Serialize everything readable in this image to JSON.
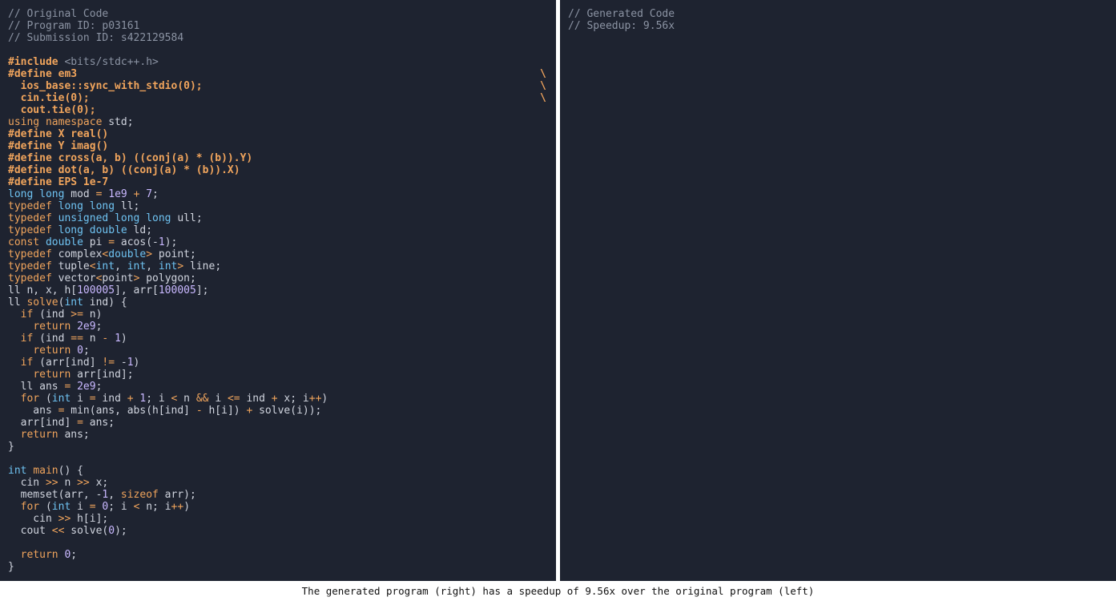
{
  "left_panel": {
    "lines": [
      [
        [
          "comment",
          "// Original Code"
        ]
      ],
      [
        [
          "comment",
          "// Program ID: p03161"
        ]
      ],
      [
        [
          "comment",
          "// Submission ID: s422129584"
        ]
      ],
      [],
      [
        [
          "pre",
          "#include "
        ],
        [
          "inc",
          "<bits/stdc++.h>"
        ]
      ],
      [
        [
          "pre",
          "#define em3"
        ],
        [
          "bs",
          "\\"
        ]
      ],
      [
        [
          "pre",
          "  ios_base::sync_with_stdio(0);"
        ],
        [
          "bs",
          "\\"
        ]
      ],
      [
        [
          "pre",
          "  cin.tie(0);"
        ],
        [
          "bs",
          "\\"
        ]
      ],
      [
        [
          "pre",
          "  cout.tie(0);"
        ]
      ],
      [
        [
          "kw",
          "using namespace"
        ],
        [
          "plain",
          " std;"
        ]
      ],
      [
        [
          "pre",
          "#define X real()"
        ]
      ],
      [
        [
          "pre",
          "#define Y imag()"
        ]
      ],
      [
        [
          "pre",
          "#define cross(a, b) ((conj(a) * (b)).Y)"
        ]
      ],
      [
        [
          "pre",
          "#define dot(a, b) ((conj(a) * (b)).X)"
        ]
      ],
      [
        [
          "pre",
          "#define EPS 1e-7"
        ]
      ],
      [
        [
          "type",
          "long long"
        ],
        [
          "plain",
          " mod "
        ],
        [
          "op",
          "="
        ],
        [
          "plain",
          " "
        ],
        [
          "num",
          "1e9"
        ],
        [
          "plain",
          " "
        ],
        [
          "op",
          "+"
        ],
        [
          "plain",
          " "
        ],
        [
          "num",
          "7"
        ],
        [
          "plain",
          ";"
        ]
      ],
      [
        [
          "kw",
          "typedef"
        ],
        [
          "plain",
          " "
        ],
        [
          "type",
          "long long"
        ],
        [
          "plain",
          " ll;"
        ]
      ],
      [
        [
          "kw",
          "typedef"
        ],
        [
          "plain",
          " "
        ],
        [
          "type",
          "unsigned long long"
        ],
        [
          "plain",
          " ull;"
        ]
      ],
      [
        [
          "kw",
          "typedef"
        ],
        [
          "plain",
          " "
        ],
        [
          "type",
          "long double"
        ],
        [
          "plain",
          " ld;"
        ]
      ],
      [
        [
          "kw",
          "const"
        ],
        [
          "plain",
          " "
        ],
        [
          "type",
          "double"
        ],
        [
          "plain",
          " pi "
        ],
        [
          "op",
          "="
        ],
        [
          "plain",
          " acos(-"
        ],
        [
          "num",
          "1"
        ],
        [
          "plain",
          ");"
        ]
      ],
      [
        [
          "kw",
          "typedef"
        ],
        [
          "plain",
          " complex"
        ],
        [
          "op",
          "<"
        ],
        [
          "type",
          "double"
        ],
        [
          "op",
          ">"
        ],
        [
          "plain",
          " point;"
        ]
      ],
      [
        [
          "kw",
          "typedef"
        ],
        [
          "plain",
          " tuple"
        ],
        [
          "op",
          "<"
        ],
        [
          "type",
          "int"
        ],
        [
          "plain",
          ", "
        ],
        [
          "type",
          "int"
        ],
        [
          "plain",
          ", "
        ],
        [
          "type",
          "int"
        ],
        [
          "op",
          ">"
        ],
        [
          "plain",
          " line;"
        ]
      ],
      [
        [
          "kw",
          "typedef"
        ],
        [
          "plain",
          " vector"
        ],
        [
          "op",
          "<"
        ],
        [
          "plain",
          "point"
        ],
        [
          "op",
          ">"
        ],
        [
          "plain",
          " polygon;"
        ]
      ],
      [
        [
          "plain",
          "ll n, x, h["
        ],
        [
          "num",
          "100005"
        ],
        [
          "plain",
          "], arr["
        ],
        [
          "num",
          "100005"
        ],
        [
          "plain",
          "];"
        ]
      ],
      [
        [
          "plain",
          "ll "
        ],
        [
          "fn",
          "solve"
        ],
        [
          "plain",
          "("
        ],
        [
          "type",
          "int"
        ],
        [
          "plain",
          " ind) {"
        ]
      ],
      [
        [
          "plain",
          "  "
        ],
        [
          "kw",
          "if"
        ],
        [
          "plain",
          " (ind "
        ],
        [
          "op",
          ">="
        ],
        [
          "plain",
          " n)"
        ]
      ],
      [
        [
          "plain",
          "    "
        ],
        [
          "kw",
          "return"
        ],
        [
          "plain",
          " "
        ],
        [
          "num",
          "2e9"
        ],
        [
          "plain",
          ";"
        ]
      ],
      [
        [
          "plain",
          "  "
        ],
        [
          "kw",
          "if"
        ],
        [
          "plain",
          " (ind "
        ],
        [
          "op",
          "=="
        ],
        [
          "plain",
          " n "
        ],
        [
          "op",
          "-"
        ],
        [
          "plain",
          " "
        ],
        [
          "num",
          "1"
        ],
        [
          "plain",
          ")"
        ]
      ],
      [
        [
          "plain",
          "    "
        ],
        [
          "kw",
          "return"
        ],
        [
          "plain",
          " "
        ],
        [
          "num",
          "0"
        ],
        [
          "plain",
          ";"
        ]
      ],
      [
        [
          "plain",
          "  "
        ],
        [
          "kw",
          "if"
        ],
        [
          "plain",
          " (arr[ind] "
        ],
        [
          "op",
          "!="
        ],
        [
          "plain",
          " -"
        ],
        [
          "num",
          "1"
        ],
        [
          "plain",
          ")"
        ]
      ],
      [
        [
          "plain",
          "    "
        ],
        [
          "kw",
          "return"
        ],
        [
          "plain",
          " arr[ind];"
        ]
      ],
      [
        [
          "plain",
          "  ll ans "
        ],
        [
          "op",
          "="
        ],
        [
          "plain",
          " "
        ],
        [
          "num",
          "2e9"
        ],
        [
          "plain",
          ";"
        ]
      ],
      [
        [
          "plain",
          "  "
        ],
        [
          "kw",
          "for"
        ],
        [
          "plain",
          " ("
        ],
        [
          "type",
          "int"
        ],
        [
          "plain",
          " i "
        ],
        [
          "op",
          "="
        ],
        [
          "plain",
          " ind "
        ],
        [
          "op",
          "+"
        ],
        [
          "plain",
          " "
        ],
        [
          "num",
          "1"
        ],
        [
          "plain",
          "; i "
        ],
        [
          "op",
          "<"
        ],
        [
          "plain",
          " n "
        ],
        [
          "op",
          "&&"
        ],
        [
          "plain",
          " i "
        ],
        [
          "op",
          "<="
        ],
        [
          "plain",
          " ind "
        ],
        [
          "op",
          "+"
        ],
        [
          "plain",
          " x; i"
        ],
        [
          "op",
          "++"
        ],
        [
          "plain",
          ")"
        ]
      ],
      [
        [
          "plain",
          "    ans "
        ],
        [
          "op",
          "="
        ],
        [
          "plain",
          " min(ans, abs(h[ind] "
        ],
        [
          "op",
          "-"
        ],
        [
          "plain",
          " h[i]) "
        ],
        [
          "op",
          "+"
        ],
        [
          "plain",
          " solve(i));"
        ]
      ],
      [
        [
          "plain",
          "  arr[ind] "
        ],
        [
          "op",
          "="
        ],
        [
          "plain",
          " ans;"
        ]
      ],
      [
        [
          "plain",
          "  "
        ],
        [
          "kw",
          "return"
        ],
        [
          "plain",
          " ans;"
        ]
      ],
      [
        [
          "plain",
          "}"
        ]
      ],
      [],
      [
        [
          "type",
          "int"
        ],
        [
          "plain",
          " "
        ],
        [
          "fn",
          "main"
        ],
        [
          "plain",
          "() {"
        ]
      ],
      [
        [
          "plain",
          "  cin "
        ],
        [
          "op",
          ">>"
        ],
        [
          "plain",
          " n "
        ],
        [
          "op",
          ">>"
        ],
        [
          "plain",
          " x;"
        ]
      ],
      [
        [
          "plain",
          "  memset(arr, -"
        ],
        [
          "num",
          "1"
        ],
        [
          "plain",
          ", "
        ],
        [
          "kw",
          "sizeof"
        ],
        [
          "plain",
          " arr);"
        ]
      ],
      [
        [
          "plain",
          "  "
        ],
        [
          "kw",
          "for"
        ],
        [
          "plain",
          " ("
        ],
        [
          "type",
          "int"
        ],
        [
          "plain",
          " i "
        ],
        [
          "op",
          "="
        ],
        [
          "plain",
          " "
        ],
        [
          "num",
          "0"
        ],
        [
          "plain",
          "; i "
        ],
        [
          "op",
          "<"
        ],
        [
          "plain",
          " n; i"
        ],
        [
          "op",
          "++"
        ],
        [
          "plain",
          ")"
        ]
      ],
      [
        [
          "plain",
          "    cin "
        ],
        [
          "op",
          ">>"
        ],
        [
          "plain",
          " h[i];"
        ]
      ],
      [
        [
          "plain",
          "  cout "
        ],
        [
          "op",
          "<<"
        ],
        [
          "plain",
          " solve("
        ],
        [
          "num",
          "0"
        ],
        [
          "plain",
          ");"
        ]
      ],
      [],
      [
        [
          "plain",
          "  "
        ],
        [
          "kw",
          "return"
        ],
        [
          "plain",
          " "
        ],
        [
          "num",
          "0"
        ],
        [
          "plain",
          ";"
        ]
      ],
      [
        [
          "plain",
          "}"
        ]
      ]
    ]
  },
  "right_panel": {
    "lines": [
      [
        [
          "comment",
          "// Generated Code"
        ]
      ],
      [
        [
          "comment",
          "// Speedup: 9.56x"
        ]
      ]
    ]
  },
  "caption": "The generated program (right) has a speedup of 9.56x over the original program (left)"
}
